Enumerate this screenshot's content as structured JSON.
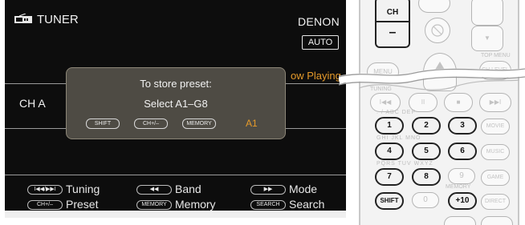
{
  "tv": {
    "icon": "tuner-icon",
    "title": "TUNER",
    "brand": "DENON",
    "auto_badge": "AUTO",
    "now_playing": "ow Playing",
    "channel": "CH A",
    "popup": {
      "line1": "To store preset:",
      "line2": "Select A1–G8",
      "shift": "SHIFT",
      "ch": "CH+/–",
      "memory": "MEMORY",
      "preset_value": "A1"
    },
    "guide": {
      "tuning_btn": "I◀◀/▶▶I",
      "tuning": "Tuning",
      "band_btn": "◀◀",
      "band": "Band",
      "mode_btn": "▶▶",
      "mode": "Mode",
      "preset_btn": "CH+/–",
      "preset": "Preset",
      "memory_btn": "MEMORY",
      "memory": "Memory",
      "search_btn": "SEARCH",
      "search": "Search"
    }
  },
  "remote": {
    "ch": "CH",
    "minus": "–",
    "menu": "MENU",
    "top_menu": "TOP MENU",
    "ch_level": "CH LEVEL",
    "tuning_label": "TUNING",
    "labels": {
      "r1": ". / ABC DEF",
      "r2": "GHI JKL MNO",
      "r3": "PQRS TUV WXYZ",
      "r4": "LINK MENU  ... +10  MEMORY"
    },
    "keys": [
      "1",
      "2",
      "3",
      "4",
      "5",
      "6",
      "7",
      "8",
      "9",
      "0"
    ],
    "side": {
      "movie": "MOVIE",
      "music": "MUSIC",
      "game": "GAME",
      "direct": "DIRECT"
    },
    "shift": "SHIFT",
    "plus10": "+10",
    "memory": "MEMORY"
  }
}
